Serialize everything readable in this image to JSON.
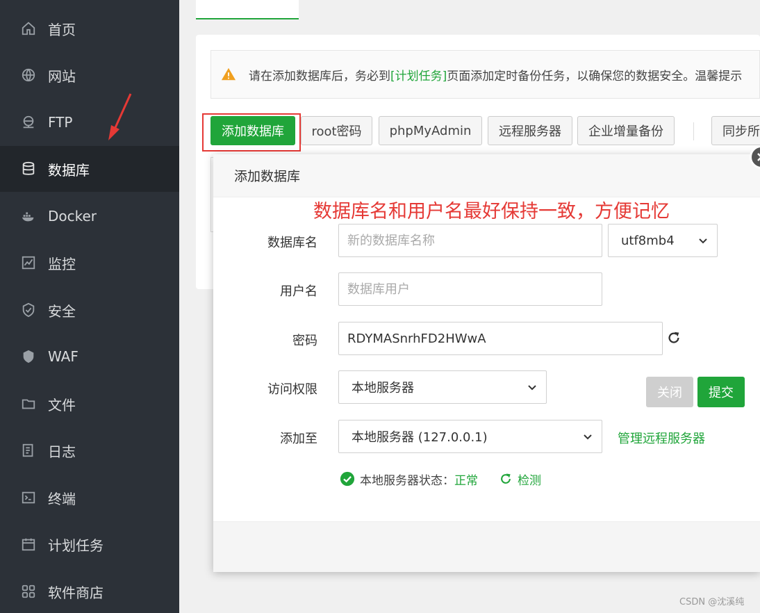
{
  "sidebar": {
    "items": [
      {
        "label": "首页",
        "icon": "home-icon"
      },
      {
        "label": "网站",
        "icon": "globe-icon"
      },
      {
        "label": "FTP",
        "icon": "ftp-icon"
      },
      {
        "label": "数据库",
        "icon": "database-icon",
        "active": true
      },
      {
        "label": "Docker",
        "icon": "docker-icon"
      },
      {
        "label": "监控",
        "icon": "monitor-icon"
      },
      {
        "label": "安全",
        "icon": "shield-icon"
      },
      {
        "label": "WAF",
        "icon": "waf-icon"
      },
      {
        "label": "文件",
        "icon": "folder-icon"
      },
      {
        "label": "日志",
        "icon": "log-icon"
      },
      {
        "label": "终端",
        "icon": "terminal-icon"
      },
      {
        "label": "计划任务",
        "icon": "calendar-icon"
      },
      {
        "label": "软件商店",
        "icon": "apps-icon"
      }
    ]
  },
  "notice": {
    "before": "请在添加数据库后，务必到",
    "link": "[计划任务]",
    "after": "页面添加定时备份任务，以确保您的数据安全。温馨提示"
  },
  "toolbar": {
    "add_db": "添加数据库",
    "root_pwd": "root密码",
    "phpmyadmin": "phpMyAdmin",
    "remote_server": "远程服务器",
    "enterprise_backup": "企业增量备份",
    "sync": "同步所"
  },
  "modal": {
    "title": "添加数据库",
    "hint": "数据库名和用户名最好保持一致，方便记忆",
    "db_name_label": "数据库名",
    "db_name_placeholder": "新的数据库名称",
    "charset": "utf8mb4",
    "user_label": "用户名",
    "user_placeholder": "数据库用户",
    "pwd_label": "密码",
    "pwd_value": "RDYMASnrhFD2HWwA",
    "access_label": "访问权限",
    "access_value": "本地服务器",
    "add_to_label": "添加至",
    "add_to_value": "本地服务器 (127.0.0.1)",
    "manage_remote": "管理远程服务器",
    "status_label": "本地服务器状态：",
    "status_value": "正常",
    "check": "检测",
    "close_btn": "关闭",
    "submit_btn": "提交"
  },
  "colors": {
    "brand_green": "#20a53a",
    "annotation_red": "#e53935",
    "sidebar_bg": "#2c3138"
  },
  "watermark": "CSDN @沈溪纯"
}
